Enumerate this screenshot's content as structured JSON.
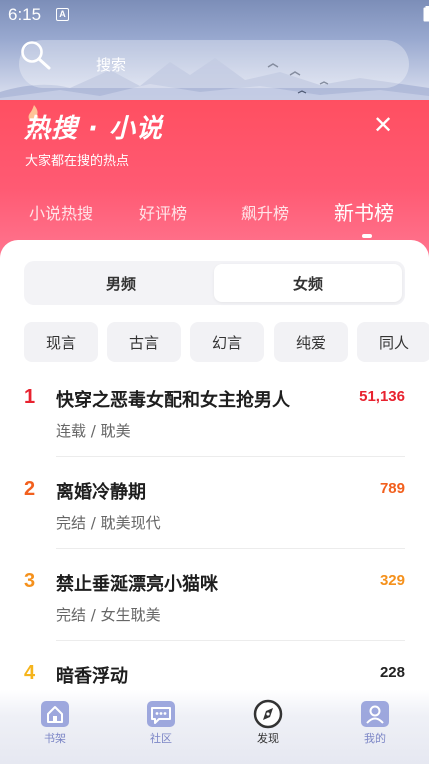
{
  "status_bar": {
    "time": "6:15",
    "notification_glyph": "A"
  },
  "search": {
    "placeholder": "搜索"
  },
  "header": {
    "title": "热搜 · 小说",
    "subtitle": "大家都在搜的热点",
    "close_symbol": "✕"
  },
  "rank_tabs": [
    {
      "label": "小说热搜",
      "active": false
    },
    {
      "label": "好评榜",
      "active": false
    },
    {
      "label": "飙升榜",
      "active": false
    },
    {
      "label": "新书榜",
      "active": true
    }
  ],
  "gender_toggle": {
    "options": [
      {
        "label": "男频",
        "selected": false
      },
      {
        "label": "女频",
        "selected": true
      }
    ]
  },
  "genres": [
    "现言",
    "古言",
    "幻言",
    "纯爱",
    "同人"
  ],
  "books": [
    {
      "rank": "1",
      "title": "快穿之恶毒女配和女主抢男人",
      "meta": "连载 / 耽美",
      "count": "51,136",
      "color": "#e8222f"
    },
    {
      "rank": "2",
      "title": "离婚冷静期",
      "meta": "完结 / 耽美现代",
      "count": "789",
      "color": "#f2601e"
    },
    {
      "rank": "3",
      "title": "禁止垂涎漂亮小猫咪",
      "meta": "完结 / 女生耽美",
      "count": "329",
      "color": "#f5911c"
    },
    {
      "rank": "4",
      "title": "暗香浮动",
      "meta": "",
      "count": "228",
      "color": "#f5b41c"
    }
  ],
  "bottom_nav": [
    {
      "label": "书架",
      "icon": "home-icon",
      "active": false
    },
    {
      "label": "社区",
      "icon": "chat-icon",
      "active": false
    },
    {
      "label": "发现",
      "icon": "compass-icon",
      "active": true
    },
    {
      "label": "我的",
      "icon": "person-icon",
      "active": false
    }
  ],
  "colors": {
    "header_red": "#ff4f61",
    "rank1": "#e8222f",
    "rank2": "#f2601e",
    "rank3": "#f5911c",
    "rank4": "#f5b41c",
    "nav_inactive": "#7c86c6"
  }
}
